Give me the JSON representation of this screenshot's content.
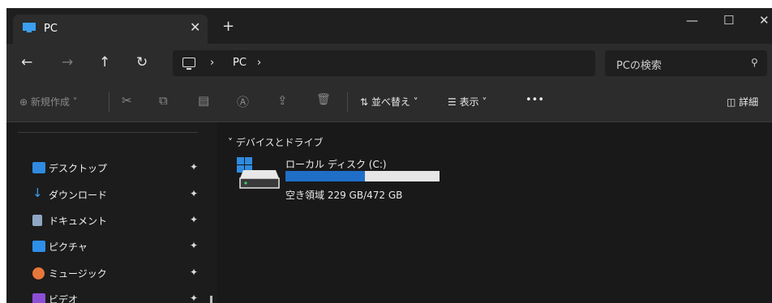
{
  "tab": {
    "title": "PC",
    "close": "✕",
    "new_tab": "+"
  },
  "window_controls": {
    "minimize": "—",
    "maximize": "☐",
    "close": "✕"
  },
  "nav": {
    "back": "←",
    "forward": "→",
    "up": "↑",
    "refresh": "↻"
  },
  "address": {
    "chevron": "›",
    "segment": "PC",
    "trailing": "›"
  },
  "search": {
    "placeholder": "PCの検索",
    "icon": "⚲"
  },
  "commands": {
    "new": "⊕ 新規作成 ˅",
    "cut": "✂",
    "copy": "⧉",
    "paste": "▤",
    "rename": "Ⓐ",
    "share": "⇪",
    "delete": "🗑",
    "sort": "⇅ 並べ替え ˅",
    "view": "☰ 表示 ˅",
    "more": "•••",
    "details": "◫ 詳細"
  },
  "sidebar": {
    "items": [
      {
        "label": "デスクトップ",
        "color": "#2f8be0"
      },
      {
        "label": "ダウンロード",
        "color": "#3aa0f0"
      },
      {
        "label": "ドキュメント",
        "color": "#8fa6c4"
      },
      {
        "label": "ピクチャ",
        "color": "#2e8fe8"
      },
      {
        "label": "ミュージック",
        "color": "#e8763a"
      },
      {
        "label": "ビデオ",
        "color": "#8b4fd6"
      }
    ],
    "pin": "📌"
  },
  "content": {
    "group": "˅ デバイスとドライブ",
    "drive": {
      "name": "ローカル ディスク (C:)",
      "free_text": "空き領域 229 GB/472 GB",
      "used_fraction": 0.515,
      "bar_color": "#1f6fc9"
    }
  }
}
